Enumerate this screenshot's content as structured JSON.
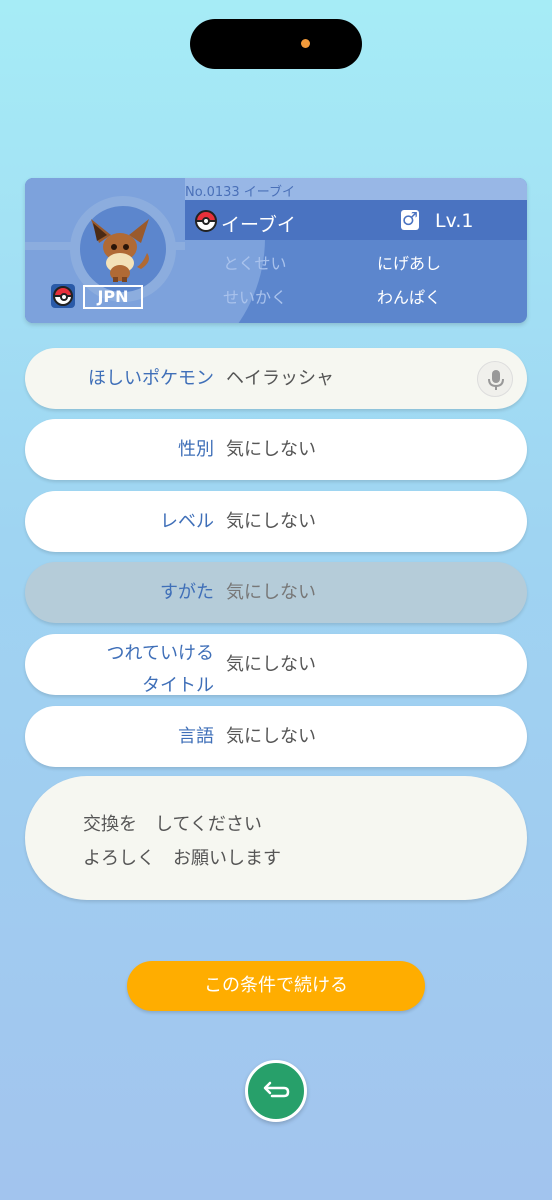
{
  "pokemon_card": {
    "dex_label": "No.0133 イーブイ",
    "name": "イーブイ",
    "gender_symbol": "♂",
    "level": "Lv.1",
    "ability_label": "とくせい",
    "ability_value": "にげあし",
    "nature_label": "せいかく",
    "nature_value": "わんぱく",
    "region": "JPN"
  },
  "fields": {
    "wanted_pokemon": {
      "label": "ほしいポケモン",
      "value": "ヘイラッシャ"
    },
    "gender": {
      "label": "性別",
      "value": "気にしない"
    },
    "level": {
      "label": "レベル",
      "value": "気にしない"
    },
    "form": {
      "label": "すがた",
      "value": "気にしない"
    },
    "title": {
      "label_line1": "つれていける",
      "label_line2": "タイトル",
      "value": "気にしない"
    },
    "language": {
      "label": "言語",
      "value": "気にしない"
    }
  },
  "message": {
    "line1": "交換を　してください",
    "line2": "よろしく　お願いします"
  },
  "continue_button": "この条件で続ける",
  "colors": {
    "accent_orange": "#ffad00",
    "back_green": "#27a06a",
    "label_blue": "#3f6fb8",
    "card_blue": "#5c86cd"
  }
}
